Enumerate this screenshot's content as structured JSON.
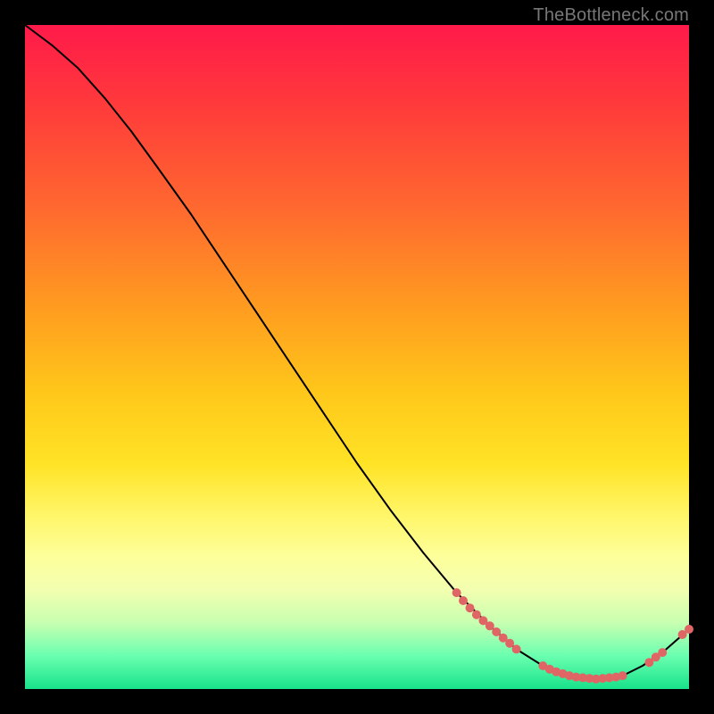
{
  "watermark": "TheBottleneck.com",
  "colors": {
    "black": "#000000",
    "dot": "#e06666",
    "gradient_top": "#ff1a4a",
    "gradient_bottom": "#18e28a"
  },
  "chart_data": {
    "type": "line",
    "title": "",
    "xlabel": "",
    "ylabel": "",
    "xlim": [
      0,
      100
    ],
    "ylim": [
      0,
      100
    ],
    "grid": false,
    "legend": false,
    "annotations": [],
    "series": [
      {
        "name": "curve",
        "x": [
          0,
          4,
          8,
          12,
          16,
          20,
          25,
          30,
          35,
          40,
          45,
          50,
          55,
          60,
          65,
          70,
          74,
          78,
          82,
          86,
          90,
          93,
          96,
          100
        ],
        "y": [
          100,
          97,
          93.5,
          89,
          84,
          78.5,
          71.5,
          64,
          56.5,
          49,
          41.5,
          34,
          27,
          20.5,
          14.5,
          9.5,
          6,
          3.5,
          2,
          1.5,
          2,
          3.5,
          5.5,
          9
        ]
      }
    ],
    "clusters": [
      {
        "name": "left-cluster",
        "note": "cluster on steep descent",
        "points": [
          {
            "x": 65,
            "y": 14.5
          },
          {
            "x": 66,
            "y": 13.3
          },
          {
            "x": 67,
            "y": 12.2
          },
          {
            "x": 68,
            "y": 11.2
          },
          {
            "x": 69,
            "y": 10.3
          },
          {
            "x": 70,
            "y": 9.5
          },
          {
            "x": 71,
            "y": 8.6
          },
          {
            "x": 72,
            "y": 7.7
          },
          {
            "x": 73,
            "y": 6.9
          },
          {
            "x": 74,
            "y": 6.0
          }
        ]
      },
      {
        "name": "trough-cluster",
        "note": "flat bottom of valley",
        "points": [
          {
            "x": 78,
            "y": 3.5
          },
          {
            "x": 79,
            "y": 3.0
          },
          {
            "x": 80,
            "y": 2.6
          },
          {
            "x": 81,
            "y": 2.3
          },
          {
            "x": 82,
            "y": 2.0
          },
          {
            "x": 83,
            "y": 1.8
          },
          {
            "x": 84,
            "y": 1.7
          },
          {
            "x": 85,
            "y": 1.6
          },
          {
            "x": 86,
            "y": 1.5
          },
          {
            "x": 87,
            "y": 1.6
          },
          {
            "x": 88,
            "y": 1.7
          },
          {
            "x": 89,
            "y": 1.8
          },
          {
            "x": 90,
            "y": 2.0
          }
        ]
      },
      {
        "name": "right-cluster",
        "note": "rising tail",
        "points": [
          {
            "x": 94,
            "y": 4.0
          },
          {
            "x": 95,
            "y": 4.8
          },
          {
            "x": 96,
            "y": 5.5
          },
          {
            "x": 99,
            "y": 8.2
          },
          {
            "x": 100,
            "y": 9.0
          }
        ]
      }
    ]
  }
}
